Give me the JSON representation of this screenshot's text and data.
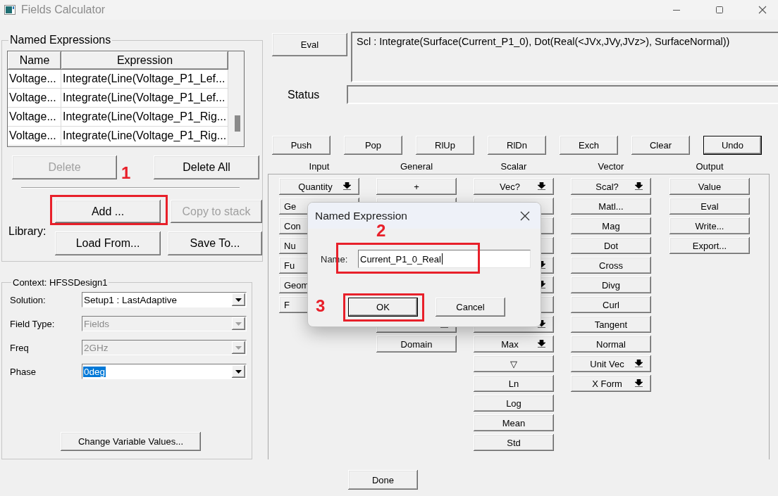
{
  "window": {
    "title": "Fields Calculator"
  },
  "named_expressions": {
    "title": "Named Expressions",
    "columns": [
      "Name",
      "Expression"
    ],
    "rows": [
      {
        "name": "Voltage...",
        "expression": "Integrate(Line(Voltage_P1_Lef..."
      },
      {
        "name": "Voltage...",
        "expression": "Integrate(Line(Voltage_P1_Lef..."
      },
      {
        "name": "Voltage...",
        "expression": "Integrate(Line(Voltage_P1_Rig..."
      },
      {
        "name": "Voltage...",
        "expression": "Integrate(Line(Voltage_P1_Rig..."
      }
    ],
    "buttons": [
      {
        "label": "Delete",
        "disabled": true
      },
      {
        "label": "Delete All",
        "disabled": false
      }
    ],
    "library": {
      "label": "Library:",
      "buttons": [
        {
          "label": "Add ...",
          "disabled": false
        },
        {
          "label": "Copy to stack",
          "disabled": true
        },
        {
          "label": "Load From...",
          "disabled": false
        },
        {
          "label": "Save To...",
          "disabled": false
        }
      ]
    }
  },
  "context": {
    "title": "Context: HFSSDesign1",
    "fields": [
      {
        "label": "Solution:",
        "value": "Setup1 : LastAdaptive",
        "disabled": false,
        "selected": false
      },
      {
        "label": "Field Type:",
        "value": "Fields",
        "disabled": true,
        "selected": false
      },
      {
        "label": "Freq",
        "value": "2GHz",
        "disabled": true,
        "selected": false
      },
      {
        "label": "Phase",
        "value": "0deg",
        "disabled": false,
        "selected": true
      }
    ],
    "button": "Change Variable Values..."
  },
  "eval_button": "Eval",
  "expression": "Scl : Integrate(Surface(Current_P1_0), Dot(Real(<JVx,JVy,JVz>), SurfaceNormal))",
  "status_label": "Status",
  "stack_buttons": [
    {
      "label": "Push",
      "default": false
    },
    {
      "label": "Pop",
      "default": false
    },
    {
      "label": "RlUp",
      "default": false
    },
    {
      "label": "RlDn",
      "default": false
    },
    {
      "label": "Exch",
      "default": false
    },
    {
      "label": "Clear",
      "default": false
    },
    {
      "label": "Undo",
      "default": true
    }
  ],
  "columns": [
    {
      "title": "Input",
      "buttons": [
        {
          "label": "Quantity",
          "kind": "menu"
        },
        {
          "label": "Ge",
          "kind": "covered"
        },
        {
          "label": "Con",
          "kind": "covered"
        },
        {
          "label": "Nu",
          "kind": "covered"
        },
        {
          "label": "Fu",
          "kind": "covered"
        },
        {
          "label": "Geom",
          "kind": "covered"
        },
        {
          "label": "F",
          "kind": "covered"
        }
      ]
    },
    {
      "title": "General",
      "buttons": [
        {
          "label": "+",
          "kind": "plain"
        },
        {
          "kind": "blank"
        },
        {
          "kind": "blank"
        },
        {
          "kind": "blank"
        },
        {
          "kind": "blank"
        },
        {
          "kind": "blank"
        },
        {
          "kind": "blank"
        },
        {
          "kind": "menu"
        },
        {
          "label": "Domain",
          "kind": "plain"
        }
      ]
    },
    {
      "title": "Scalar",
      "buttons": [
        {
          "label": "Vec?",
          "kind": "menu"
        },
        {
          "kind": "blank"
        },
        {
          "kind": "blank"
        },
        {
          "kind": "blank"
        },
        {
          "kind": "menu"
        },
        {
          "kind": "menu"
        },
        {
          "kind": "blank"
        },
        {
          "kind": "menu"
        },
        {
          "label": "Max",
          "kind": "menu"
        },
        {
          "label": "▽",
          "kind": "plain"
        },
        {
          "label": "Ln",
          "kind": "plain"
        },
        {
          "label": "Log",
          "kind": "plain"
        },
        {
          "label": "Mean",
          "kind": "plain"
        },
        {
          "label": "Std",
          "kind": "plain"
        }
      ]
    },
    {
      "title": "Vector",
      "buttons": [
        {
          "label": "Scal?",
          "kind": "menu"
        },
        {
          "label": "Matl...",
          "kind": "plain"
        },
        {
          "label": "Mag",
          "kind": "plain"
        },
        {
          "label": "Dot",
          "kind": "plain"
        },
        {
          "label": "Cross",
          "kind": "plain"
        },
        {
          "label": "Divg",
          "kind": "plain"
        },
        {
          "label": "Curl",
          "kind": "plain"
        },
        {
          "label": "Tangent",
          "kind": "plain"
        },
        {
          "label": "Normal",
          "kind": "plain"
        },
        {
          "label": "Unit Vec",
          "kind": "menu"
        },
        {
          "label": "X Form",
          "kind": "menu"
        }
      ]
    },
    {
      "title": "Output",
      "buttons": [
        {
          "label": "Value",
          "kind": "plain"
        },
        {
          "label": "Eval",
          "kind": "plain"
        },
        {
          "label": "Write...",
          "kind": "plain"
        },
        {
          "label": "Export...",
          "kind": "plain"
        }
      ]
    }
  ],
  "done_button": "Done",
  "dialog": {
    "title": "Named Expression",
    "name_label": "Name:",
    "name_value": "Current_P1_0_Real",
    "buttons": [
      {
        "label": "OK",
        "default": true
      },
      {
        "label": "Cancel",
        "default": false
      }
    ]
  },
  "annotations": [
    {
      "number": "1"
    },
    {
      "number": "2"
    },
    {
      "number": "3"
    }
  ]
}
